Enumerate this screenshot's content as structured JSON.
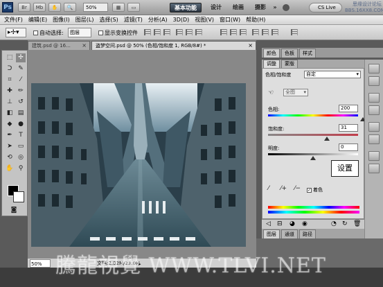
{
  "titlebar": {
    "logo": "Ps",
    "zoom": "50%",
    "workspaces": [
      "基本功能",
      "设计",
      "绘画",
      "摄影"
    ],
    "more": "»",
    "cs_live": "CS Live",
    "site_watermark_line1": "思缘设计论坛",
    "site_watermark_line2": "BBS.16XX8.COM"
  },
  "menu": [
    "文件(F)",
    "编辑(E)",
    "图像(I)",
    "图层(L)",
    "选择(S)",
    "滤镜(T)",
    "分析(A)",
    "3D(D)",
    "视图(V)",
    "窗口(W)",
    "帮助(H)"
  ],
  "options": {
    "auto_select_label": "自动选择:",
    "auto_select_value": "图层",
    "show_transform_label": "显示变换控件"
  },
  "tabs": [
    {
      "label": "建筑.psd @ 16...",
      "close": "×"
    },
    {
      "label": "盗梦空间.psd @ 50% (色相/饱和度 1, RGB/8#) *",
      "close": "×"
    }
  ],
  "status": {
    "zoom": "50%",
    "doc": "文档:2.02M/23.0M"
  },
  "panels": {
    "top_tabs": [
      "颜色",
      "色板",
      "样式"
    ],
    "adj_tabs": [
      "调整",
      "蒙版"
    ],
    "adj_title": "色相/饱和度",
    "preset": "自定",
    "channel": "全图",
    "hue_label": "色相:",
    "hue_value": "200",
    "hue_level": 200,
    "sat_label": "饱和度:",
    "sat_value": "31",
    "sat_level": 31,
    "light_label": "明度:",
    "light_value": "0",
    "light_level": 0,
    "colorize_label": "着色",
    "colorize_checked": true,
    "annotation": "设置",
    "layer_tabs": [
      "图层",
      "通道",
      "路径"
    ]
  },
  "watermark": "騰龍視覺 WWW.TLVI.NET"
}
